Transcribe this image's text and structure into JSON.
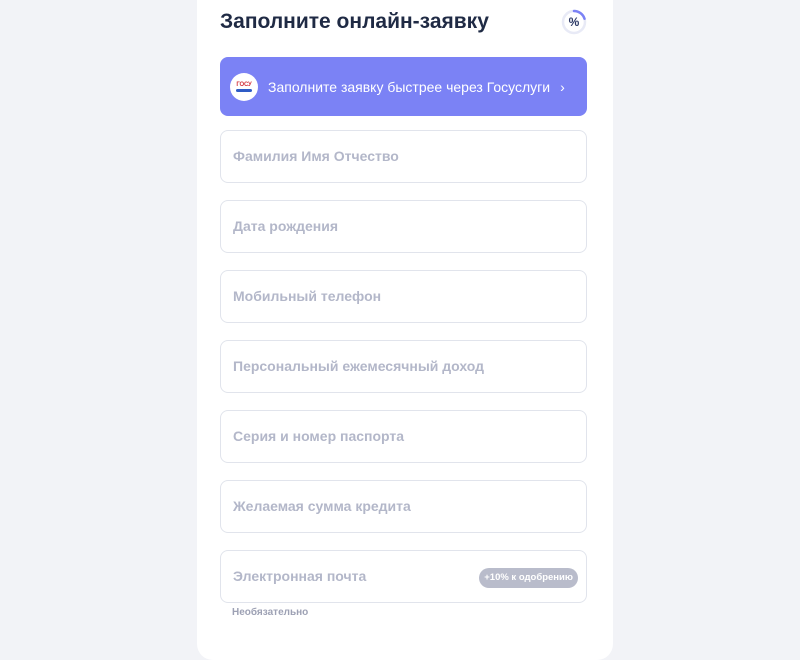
{
  "form": {
    "title": "Заполните онлайн-заявку",
    "progress_symbol": "%",
    "progress_value": 0.2,
    "accent_color": "#7b82f5",
    "gosuslugi": {
      "label": "Заполните заявку быстрее через Госуслуги",
      "logo_icon": "gosuslugi-logo-icon",
      "chevron": "›"
    },
    "fields": [
      {
        "placeholder": "Фамилия Имя Отчество"
      },
      {
        "placeholder": "Дата рождения"
      },
      {
        "placeholder": "Мобильный телефон"
      },
      {
        "placeholder": "Персональный ежемесячный доход"
      },
      {
        "placeholder": "Серия и номер паспорта"
      },
      {
        "placeholder": "Желаемая сумма кредита"
      },
      {
        "placeholder": "Электронная почта",
        "badge": "+10% к одобрению",
        "hint": "Необязательно"
      }
    ]
  }
}
